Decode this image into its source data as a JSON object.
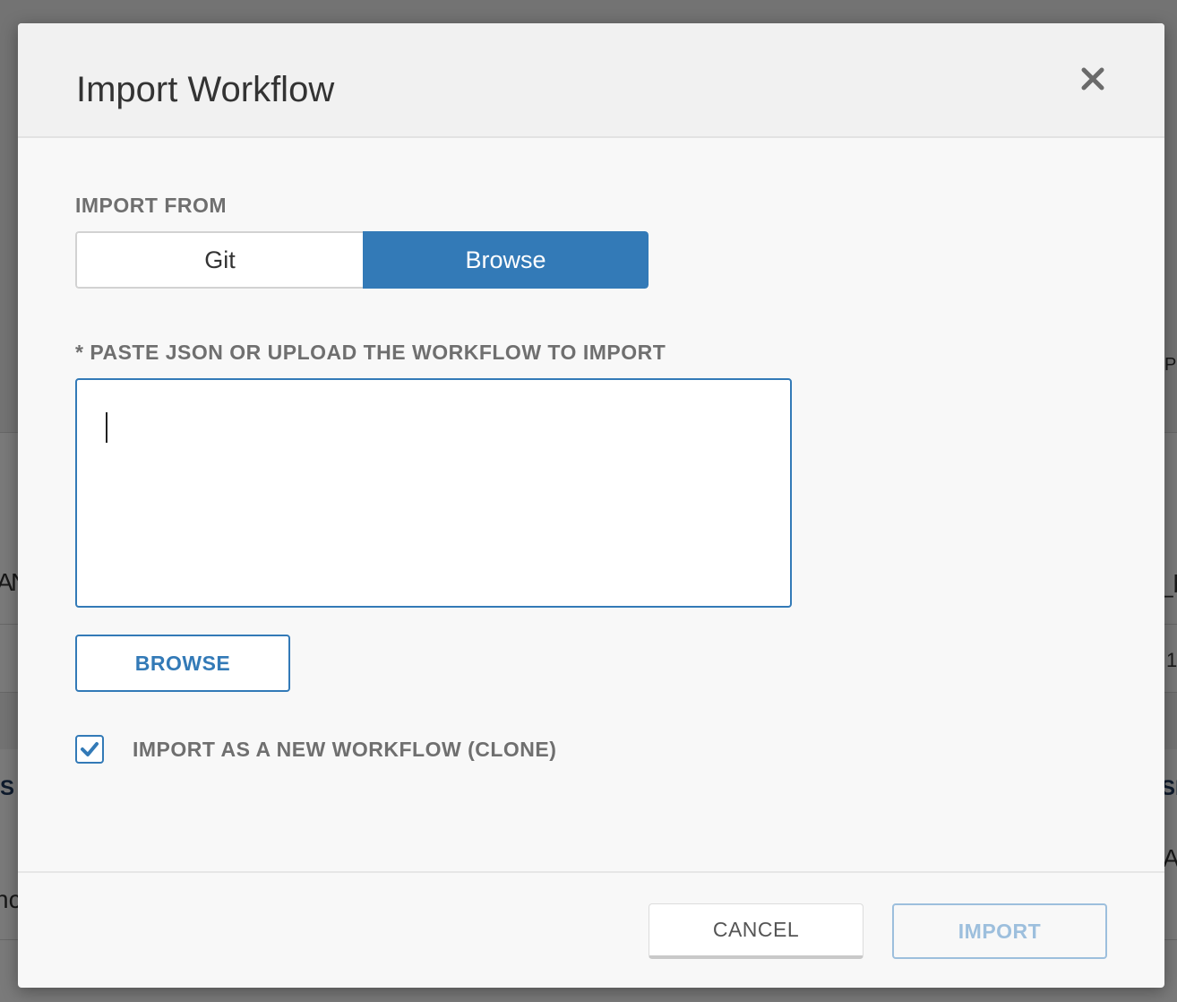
{
  "modal": {
    "title": "Import Workflow",
    "close_icon": "close-icon",
    "import_from": {
      "label": "IMPORT FROM",
      "options": [
        "Git",
        "Browse"
      ],
      "selected": "Browse"
    },
    "json_field": {
      "label": "* PASTE JSON OR UPLOAD THE WORKFLOW TO IMPORT",
      "value": "",
      "focused": true
    },
    "browse_button": "BROWSE",
    "clone_option": {
      "label": "IMPORT AS A NEW WORKFLOW (CLONE)",
      "checked": true,
      "icon": "check-icon"
    },
    "footer": {
      "cancel_label": "CANCEL",
      "import_label": "IMPORT",
      "import_disabled": true
    }
  },
  "background_fragments": [
    "A",
    "N",
    "S",
    "nc",
    "P",
    "_b",
    "1",
    "SE",
    "A"
  ],
  "colors": {
    "primary": "#337ab7",
    "primary_disabled": "#9dbfdd",
    "label_gray": "#6f6f6f",
    "overlay": "rgba(0,0,0,0.52)"
  }
}
